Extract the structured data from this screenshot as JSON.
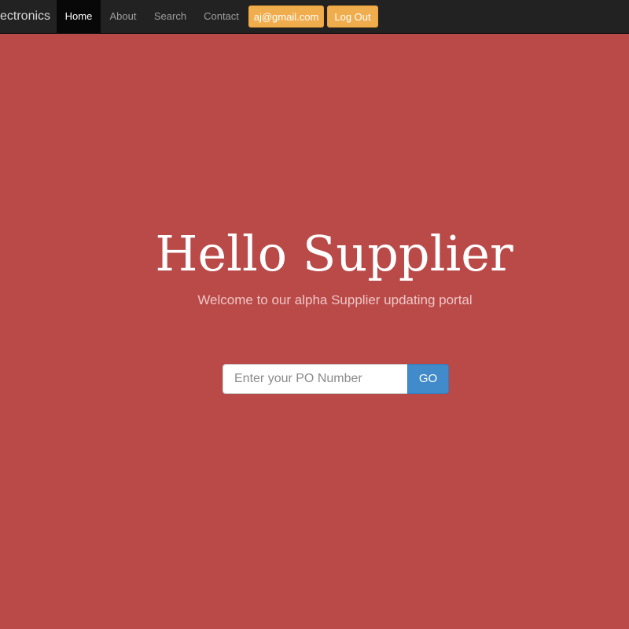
{
  "navbar": {
    "brand": "ectronics",
    "items": [
      {
        "label": "Home",
        "active": true
      },
      {
        "label": "About",
        "active": false
      },
      {
        "label": "Search",
        "active": false
      },
      {
        "label": "Contact",
        "active": false
      }
    ],
    "user_button": "aj@gmail.com",
    "logout_button": "Log Out"
  },
  "hero": {
    "title": "Hello Supplier",
    "subtitle": "Welcome to our alpha Supplier updating portal"
  },
  "search": {
    "placeholder": "Enter your PO Number",
    "value": "",
    "button_label": "GO"
  },
  "colors": {
    "background": "#b94a48",
    "navbar": "#222222",
    "warning_button": "#f0ad4e",
    "primary_button": "#428bca"
  }
}
